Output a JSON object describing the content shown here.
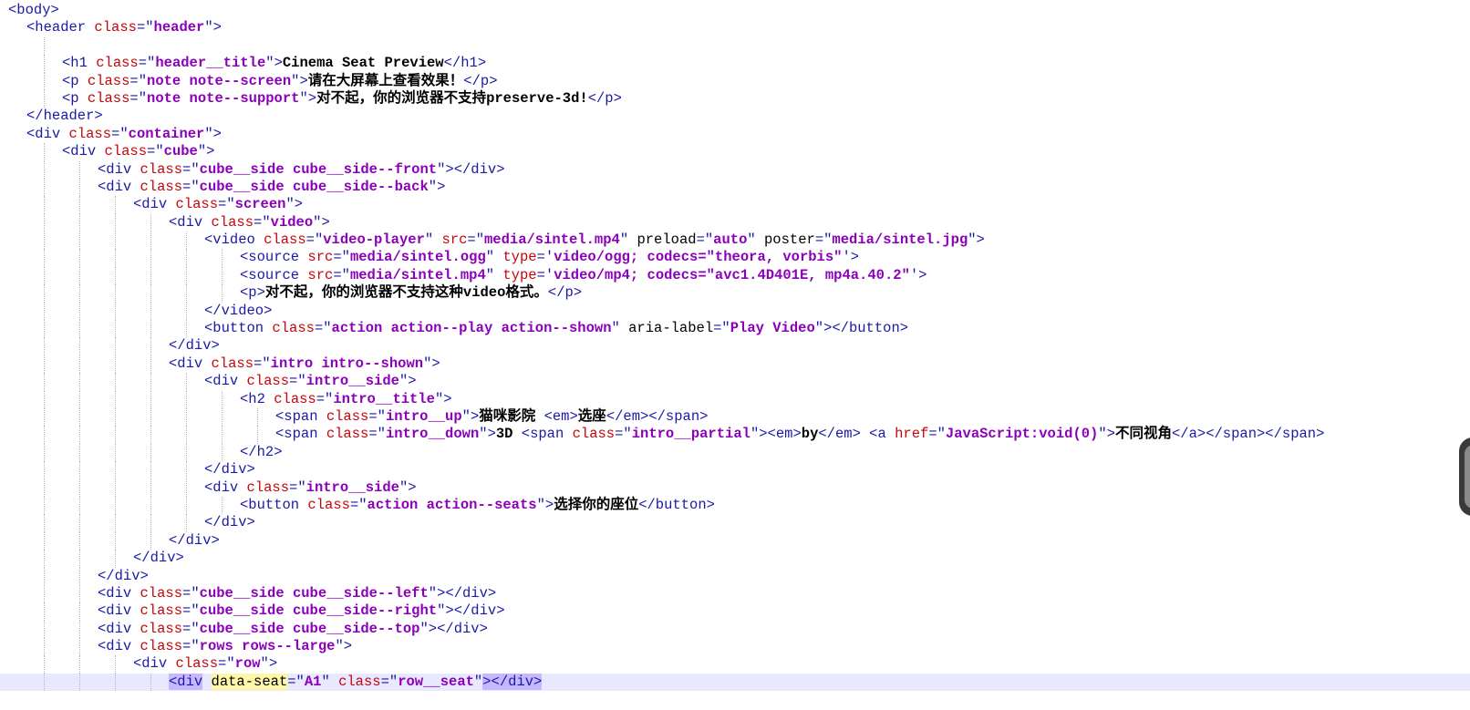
{
  "editor": {
    "lines": {
      "l1": {
        "t1": "<body>"
      },
      "l2": {
        "t1": "<header ",
        "a1": "class",
        "t2": "=\"",
        "v1": "header",
        "t3": "\">"
      },
      "l3": {},
      "l4": {
        "t1": "<h1 ",
        "a1": "class",
        "t2": "=\"",
        "v1": "header__title",
        "t3": "\">",
        "x1": "Cinema Seat Preview",
        "t4": "</h1>"
      },
      "l5": {
        "t1": "<p ",
        "a1": "class",
        "t2": "=\"",
        "v1": "note note--screen",
        "t3": "\">",
        "x1": "请在大屏幕上查看效果！",
        "t4": "</p>"
      },
      "l6": {
        "t1": "<p ",
        "a1": "class",
        "t2": "=\"",
        "v1": "note note--support",
        "t3": "\">",
        "x1": "对不起，你的浏览器不支持preserve-3d!",
        "t4": "</p>"
      },
      "l7": {
        "t1": "</header>"
      },
      "l8": {
        "t1": "<div ",
        "a1": "class",
        "t2": "=\"",
        "v1": "container",
        "t3": "\">"
      },
      "l9": {
        "t1": "<div ",
        "a1": "class",
        "t2": "=\"",
        "v1": "cube",
        "t3": "\">"
      },
      "l10": {
        "t1": "<div ",
        "a1": "class",
        "t2": "=\"",
        "v1": "cube__side cube__side--front",
        "t3": "\"></div>"
      },
      "l11": {
        "t1": "<div ",
        "a1": "class",
        "t2": "=\"",
        "v1": "cube__side cube__side--back",
        "t3": "\">"
      },
      "l12": {
        "t1": "<div ",
        "a1": "class",
        "t2": "=\"",
        "v1": "screen",
        "t3": "\">"
      },
      "l13": {
        "t1": "<div ",
        "a1": "class",
        "t2": "=\"",
        "v1": "video",
        "t3": "\">"
      },
      "l14": {
        "t1": "<video ",
        "a1": "class",
        "t2": "=\"",
        "v1": "video-player",
        "t3": "\" ",
        "a2": "src",
        "t4": "=\"",
        "v2": "media/sintel.mp4",
        "t5": "\" ",
        "p1": "preload",
        "t6": "=\"",
        "v3": "auto",
        "t7": "\" ",
        "p2": "poster",
        "t8": "=\"",
        "v4": "media/sintel.jpg",
        "t9": "\">"
      },
      "l15": {
        "t1": "<source ",
        "a1": "src",
        "t2": "=\"",
        "v1": "media/sintel.ogg",
        "t3": "\" ",
        "a2": "type",
        "t4": "='",
        "v2": "video/ogg; codecs=\"theora, vorbis\"",
        "t5": "'>"
      },
      "l16": {
        "t1": "<source ",
        "a1": "src",
        "t2": "=\"",
        "v1": "media/sintel.mp4",
        "t3": "\" ",
        "a2": "type",
        "t4": "='",
        "v2": "video/mp4; codecs=\"avc1.4D401E, mp4a.40.2\"",
        "t5": "'>"
      },
      "l17": {
        "t1": "<p>",
        "x1": "对不起，你的浏览器不支持这种video格式。",
        "t2": "</p>"
      },
      "l18": {
        "t1": "</video>"
      },
      "l19": {
        "t1": "<button ",
        "a1": "class",
        "t2": "=\"",
        "v1": "action action--play action--shown",
        "t3": "\" ",
        "p1": "aria-label",
        "t4": "=\"",
        "v2": "Play Video",
        "t5": "\"></button>"
      },
      "l20": {
        "t1": "</div>"
      },
      "l21": {
        "t1": "<div ",
        "a1": "class",
        "t2": "=\"",
        "v1": "intro intro--shown",
        "t3": "\">"
      },
      "l22": {
        "t1": "<div ",
        "a1": "class",
        "t2": "=\"",
        "v1": "intro__side",
        "t3": "\">"
      },
      "l23": {
        "t1": "<h2 ",
        "a1": "class",
        "t2": "=\"",
        "v1": "intro__title",
        "t3": "\">"
      },
      "l24": {
        "t1": "<span ",
        "a1": "class",
        "t2": "=\"",
        "v1": "intro__up",
        "t3": "\">",
        "x1": "猫咪影院 ",
        "t4": "<em>",
        "x2": "选座",
        "t5": "</em></span>"
      },
      "l25": {
        "t1": "<span ",
        "a1": "class",
        "t2": "=\"",
        "v1": "intro__down",
        "t3": "\">",
        "x1": "3D ",
        "t4": "<span ",
        "a2": "class",
        "t5": "=\"",
        "v2": "intro__partial",
        "t6": "\"><em>",
        "x2": "by",
        "t7": "</em> <a ",
        "a3": "href",
        "t8": "=\"",
        "v3": "JavaScript:void(0)",
        "t9": "\">",
        "x3": "不同视角",
        "t10": "</a></span></span>"
      },
      "l26": {
        "t1": "</h2>"
      },
      "l27": {
        "t1": "</div>"
      },
      "l28": {
        "t1": "<div ",
        "a1": "class",
        "t2": "=\"",
        "v1": "intro__side",
        "t3": "\">"
      },
      "l29": {
        "t1": "<button ",
        "a1": "class",
        "t2": "=\"",
        "v1": "action action--seats",
        "t3": "\">",
        "x1": "选择你的座位",
        "t4": "</button>"
      },
      "l30": {
        "t1": "</div>"
      },
      "l31": {
        "t1": "</div>"
      },
      "l32": {
        "t1": "</div>"
      },
      "l33": {
        "t1": "</div>"
      },
      "l34": {
        "t1": "<div ",
        "a1": "class",
        "t2": "=\"",
        "v1": "cube__side cube__side--left",
        "t3": "\"></div>"
      },
      "l35": {
        "t1": "<div ",
        "a1": "class",
        "t2": "=\"",
        "v1": "cube__side cube__side--right",
        "t3": "\"></div>"
      },
      "l36": {
        "t1": "<div ",
        "a1": "class",
        "t2": "=\"",
        "v1": "cube__side cube__side--top",
        "t3": "\"></div>"
      },
      "l37": {
        "t1": "<div ",
        "a1": "class",
        "t2": "=\"",
        "v1": "rows rows--large",
        "t3": "\">"
      },
      "l38": {
        "t1": "<div ",
        "a1": "class",
        "t2": "=\"",
        "v1": "row",
        "t3": "\">"
      },
      "l39": {
        "t1": "<div",
        "s1": " ",
        "p1": "data-seat",
        "t2": "=\"",
        "v1": "A1",
        "t3": "\" ",
        "a1": "class",
        "t4": "=\"",
        "v2": "row__seat",
        "t5": "\"",
        "t6": "></div>"
      }
    }
  }
}
